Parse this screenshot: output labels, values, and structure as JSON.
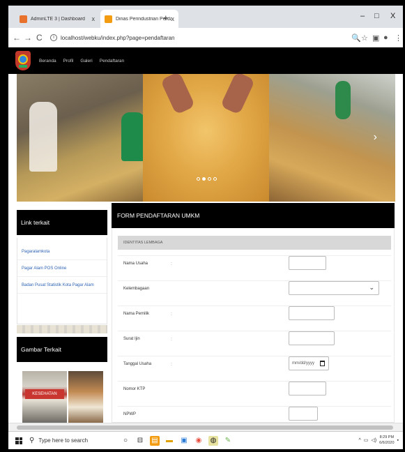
{
  "browser": {
    "tabs": [
      {
        "label": "AdminLTE 3 | Dashboard",
        "close": "x"
      },
      {
        "label": "Dinas Perindustrian Perdagangan",
        "close": "x"
      }
    ],
    "new_tab": "+",
    "window_controls": {
      "minimize": "–",
      "maximize": "□",
      "close": "X"
    },
    "nav": {
      "back": "←",
      "forward": "→",
      "reload": "C"
    },
    "url": "localhost/webku/index.php?page=pendaftaran"
  },
  "site": {
    "nav": [
      "Beranda",
      "Profil",
      "Galeri",
      "Pendaftaran"
    ],
    "slider": {
      "dots": 4,
      "active": 2
    }
  },
  "sidebar": {
    "links_title": "Link terkait",
    "links": [
      "Pagaralamkota",
      "Pagar Alam POS Online",
      "Badan Pusat Statistik Kota Pagar Alam"
    ],
    "gallery_title": "Gambar Terkait",
    "gallery_banner": "KESEHATAN"
  },
  "form": {
    "title": "FORM PENDAFTARAN UMKM",
    "section": "IDENTITAS LEMBAGA",
    "fields": [
      {
        "label": "Nama Usaha",
        "type": "text",
        "value": ""
      },
      {
        "label": "Kelembagaan",
        "type": "select",
        "value": ""
      },
      {
        "label": "Nama Pemilik",
        "type": "text",
        "value": ""
      },
      {
        "label": "Surat Ijin",
        "type": "text",
        "value": ""
      },
      {
        "label": "Tanggal Usaha",
        "type": "date",
        "value": "mm/dd/yyyy"
      },
      {
        "label": "Nomor KTP",
        "type": "text",
        "value": ""
      },
      {
        "label": "NPWP",
        "type": "text",
        "value": ""
      }
    ]
  },
  "taskbar": {
    "search_placeholder": "Type here to search",
    "time": "8:29 PM",
    "date": "6/6/2020"
  }
}
